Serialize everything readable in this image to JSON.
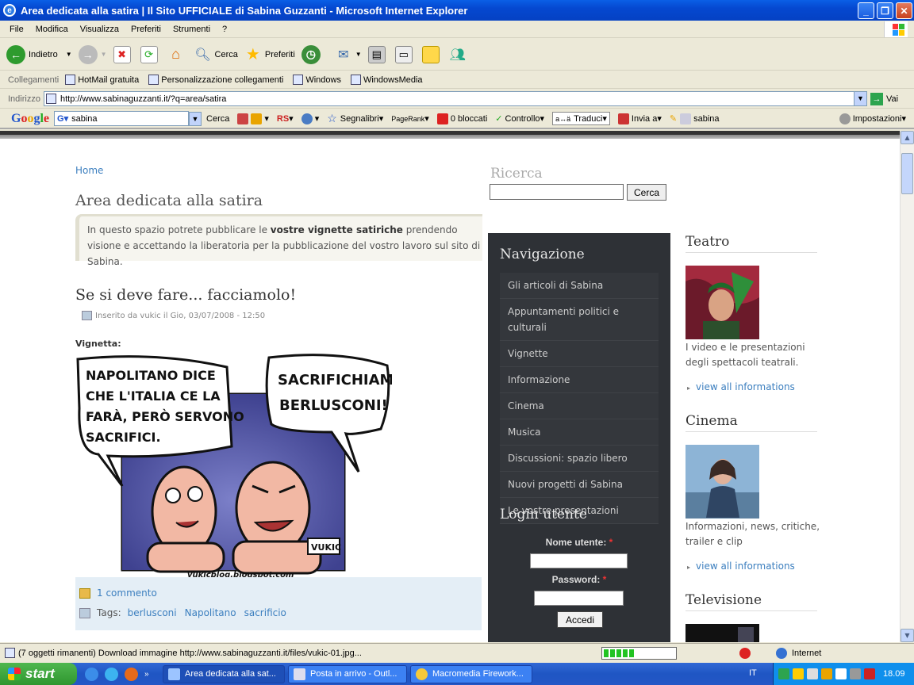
{
  "window": {
    "title": "Area dedicata alla satira | Il Sito UFFICIALE di Sabina Guzzanti - Microsoft Internet Explorer"
  },
  "menu": [
    "File",
    "Modifica",
    "Visualizza",
    "Preferiti",
    "Strumenti",
    "?"
  ],
  "toolbar": {
    "back": "Indietro",
    "search": "Cerca",
    "favorites": "Preferiti"
  },
  "links": {
    "label": "Collegamenti",
    "items": [
      "HotMail gratuita",
      "Personalizzazione collegamenti",
      "Windows",
      "WindowsMedia"
    ]
  },
  "address": {
    "label": "Indirizzo",
    "url": "http://www.sabinaguzzanti.it/?q=area/satira",
    "go": "Vai"
  },
  "googlebar": {
    "logo": "Google",
    "query": "sabina",
    "search": "Cerca",
    "bookmarks": "Segnalibri",
    "pagerank": "PageRank",
    "blocked": "0 bloccati",
    "check": "Controllo",
    "translate": "Traduci",
    "send": "Invia a",
    "highlight": "sabina",
    "settings": "Impostazioni"
  },
  "page": {
    "breadcrumb": "Home",
    "title": "Area dedicata alla satira",
    "intro_pre": "In questo spazio potrete pubblicare le ",
    "intro_bold": "vostre vignette satiriche",
    "intro_post": " prendendo visione e accettando la liberatoria per la pubblicazione del vostro lavoro sul sito di Sabina.",
    "article_title": "Se si deve fare... facciamolo!",
    "meta": "Inserito da vukic il Gio, 03/07/2008 - 12:50",
    "vignetta_label": "Vignetta:",
    "cartoon": {
      "bubble_left": [
        "NAPOLITANO DICE",
        "CHE L'ITALIA CE LA",
        "FARÀ, PERÒ SERVONO",
        "SACRIFICI."
      ],
      "bubble_right": [
        "SACRIFICHIAMO",
        "BERLUSCONI!"
      ],
      "signature": "VUKIC",
      "credit": "vukicblog.blogspot.com"
    },
    "comments": "1 commento",
    "tags_label": "Tags:",
    "tags": [
      "berlusconi",
      "Napolitano",
      "sacrificio"
    ]
  },
  "search": {
    "title": "Ricerca",
    "button": "Cerca"
  },
  "nav": {
    "title": "Navigazione",
    "items": [
      "Gli articoli di Sabina",
      "Appuntamenti politici e culturali",
      "Vignette",
      "Informazione",
      "Cinema",
      "Musica",
      "Discussioni: spazio libero",
      "Nuovi progetti di Sabina",
      "Le vostre presentazioni"
    ]
  },
  "login": {
    "title": "Login utente",
    "user_label": "Nome utente:",
    "pass_label": "Password:",
    "required": "*",
    "button": "Accedi"
  },
  "right": {
    "teatro": {
      "title": "Teatro",
      "text": "I video e le presentazioni degli spettacoli teatrali.",
      "link": "view all informations"
    },
    "cinema": {
      "title": "Cinema",
      "text": "Informazioni, news, critiche, trailer e clip",
      "link": "view all informations"
    },
    "tv": {
      "title": "Televisione"
    }
  },
  "status": {
    "text": "(7 oggetti rimanenti) Download immagine http://www.sabinaguzzanti.it/files/vukic-01.jpg...",
    "progress": 0.45,
    "zone": "Internet"
  },
  "taskbar": {
    "start": "start",
    "tasks": [
      "Area dedicata alla sat...",
      "Posta in arrivo - Outl...",
      "Macromedia Firework..."
    ],
    "lang": "IT",
    "clock": "18.09"
  },
  "colors": {
    "accent": "#3c7fbf",
    "sidebar": "#2e3136",
    "titlebar": "#0548d0"
  }
}
